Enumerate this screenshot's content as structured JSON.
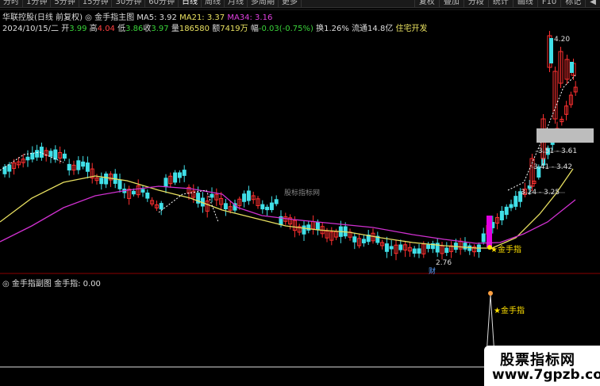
{
  "toolbar": {
    "left": [
      "分时",
      "1分钟",
      "5分钟",
      "15分钟",
      "30分钟",
      "60分钟",
      "日线",
      "周线",
      "月线",
      "多周期",
      "更多"
    ],
    "active_index": 6,
    "right": [
      "复权",
      "叠加",
      "分段",
      "统计",
      "画线",
      "F10",
      "标记",
      "◀"
    ]
  },
  "main_header": {
    "stock": "华联控股(日线 前复权)",
    "indicator": "金手指主图",
    "ma5_label": "MA5: 3.92",
    "ma21_label": "MA21: 3.37",
    "ma34_label": "MA34: 3.16"
  },
  "quote": {
    "date": "2024/10/15/二",
    "open_label": "开",
    "open": "3.99",
    "high_label": "高",
    "high": "4.04",
    "low_label": "低",
    "low": "3.86",
    "close_label": "收",
    "close": "3.97",
    "vol_label": "量",
    "volume": "186580",
    "amount_label": "额",
    "amount": "7419万",
    "change_label": "幅",
    "change": "-0.03(-0.75%)",
    "turnover": "换1.26%",
    "float": "流通14.8亿",
    "sector": "住宅开发"
  },
  "chart_labels": {
    "peak": "4.20",
    "level1": "3.51 - 3.61",
    "level2": "3.41 - 3.42",
    "level3": "3.24 - 3.25",
    "low": "2.76",
    "cai": "财",
    "signal": "★金手指"
  },
  "sub_header": {
    "title": "金手指副图",
    "value": "金手指: 0.00"
  },
  "watermark": {
    "center": "股标指标网",
    "box_line1": "股票指标网",
    "box_line2": "www.7gpzb.com"
  },
  "colors": {
    "up": "#ff3030",
    "down": "#40e0e8",
    "ma_yellow": "#e8e060",
    "ma_magenta": "#d030d0",
    "signal_bar": "#e000e0"
  }
}
